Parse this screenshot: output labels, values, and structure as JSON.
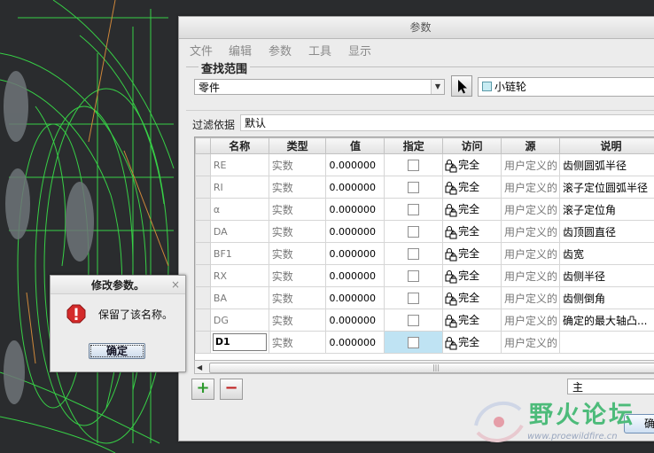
{
  "dialog": {
    "title": "参数",
    "menu": [
      "文件",
      "编辑",
      "参数",
      "工具",
      "显示"
    ],
    "search_group_label": "查找范围",
    "scope_value": "零件",
    "part_name": "小链轮",
    "filter_label": "过滤依据",
    "filter_value": "默认",
    "columns": [
      "名称",
      "类型",
      "值",
      "指定",
      "访问",
      "源",
      "说明"
    ],
    "rows": [
      {
        "name": "RE",
        "type": "实数",
        "value": "0.000000",
        "access": "完全",
        "source": "用户定义的",
        "desc": "齿侧圆弧半径"
      },
      {
        "name": "RI",
        "type": "实数",
        "value": "0.000000",
        "access": "完全",
        "source": "用户定义的",
        "desc": "滚子定位圆弧半径"
      },
      {
        "name": "α",
        "type": "实数",
        "value": "0.000000",
        "access": "完全",
        "source": "用户定义的",
        "desc": "滚子定位角"
      },
      {
        "name": "DA",
        "type": "实数",
        "value": "0.000000",
        "access": "完全",
        "source": "用户定义的",
        "desc": "齿顶圆直径"
      },
      {
        "name": "BF1",
        "type": "实数",
        "value": "0.000000",
        "access": "完全",
        "source": "用户定义的",
        "desc": "齿宽"
      },
      {
        "name": "RX",
        "type": "实数",
        "value": "0.000000",
        "access": "完全",
        "source": "用户定义的",
        "desc": "齿侧半径"
      },
      {
        "name": "BA",
        "type": "实数",
        "value": "0.000000",
        "access": "完全",
        "source": "用户定义的",
        "desc": "齿侧倒角"
      },
      {
        "name": "DG",
        "type": "实数",
        "value": "0.000000",
        "access": "完全",
        "source": "用户定义的",
        "desc": "确定的最大轴凸..."
      },
      {
        "name": "D1",
        "type": "实数",
        "value": "0.000000",
        "access": "完全",
        "source": "用户定义的",
        "desc": ""
      }
    ],
    "add_label": "+",
    "remove_label": "−",
    "bottom_combo_value": "主",
    "ok_partial_label": "确"
  },
  "message_box": {
    "title": "修改参数。",
    "text": "保留了该名称。",
    "ok_label": "确定",
    "close_glyph": "×"
  },
  "watermark": {
    "text": "野火论坛",
    "url": "www.proewildfire.cn"
  },
  "colors": {
    "add_green": "#2c9a2c",
    "remove_red": "#c02020",
    "error_red": "#d42a2a",
    "cad_green": "#3cd24a",
    "selection_blue": "#bfe3f3"
  }
}
